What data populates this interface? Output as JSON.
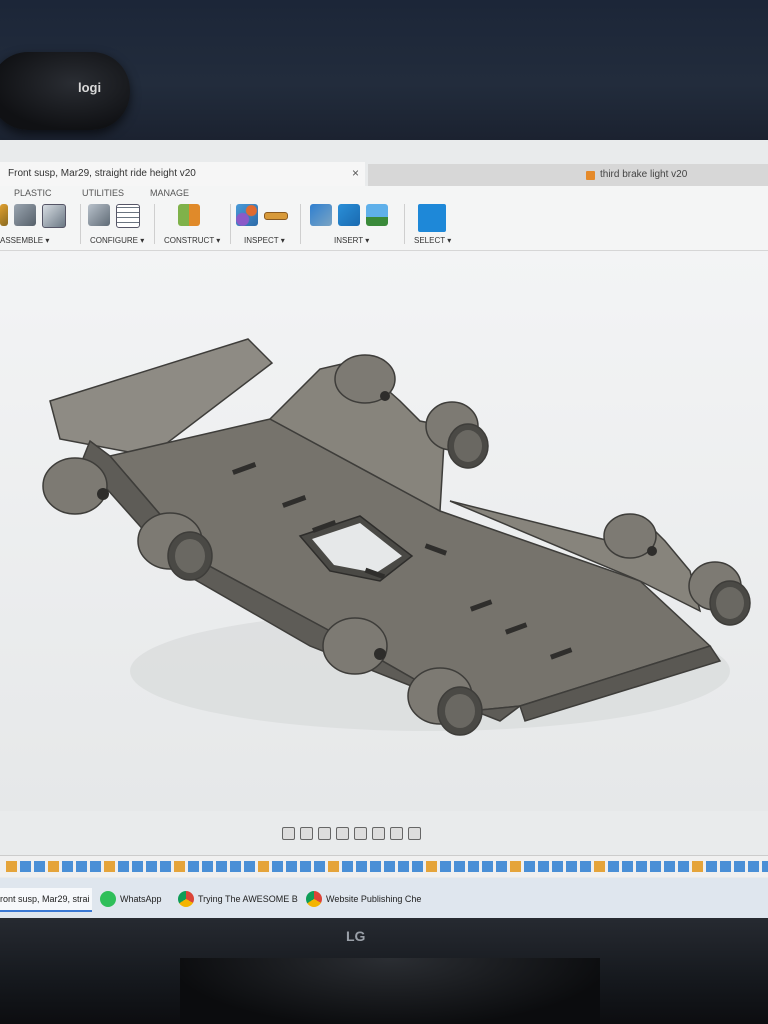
{
  "webcam": {
    "brand": "logi"
  },
  "window": {
    "active_tab_title": "Front susp, Mar29, straight ride height v20",
    "close_glyph": "×",
    "inactive_tab_title": "third brake light v20"
  },
  "ribbon": {
    "tabs": [
      "PLASTIC",
      "UTILITIES",
      "MANAGE"
    ],
    "groups": [
      {
        "label": "ASSEMBLE ▾",
        "icon": "assemble-icon"
      },
      {
        "label": "CONFIGURE ▾",
        "icon": "configure-icon"
      },
      {
        "label": "CONSTRUCT ▾",
        "icon": "construct-icon"
      },
      {
        "label": "INSPECT ▾",
        "icon": "inspect-icon"
      },
      {
        "label": "INSERT ▾",
        "icon": "insert-icon"
      },
      {
        "label": "SELECT ▾",
        "icon": "select-icon"
      }
    ]
  },
  "taskbar": {
    "items": [
      {
        "label": "ront susp, Mar29, strai",
        "icon": "fusion-icon"
      },
      {
        "label": "WhatsApp",
        "icon": "whatsapp-icon"
      },
      {
        "label": "Trying The AWESOME B",
        "icon": "chrome-icon"
      },
      {
        "label": "Website Publishing Che",
        "icon": "chrome-icon"
      }
    ]
  },
  "monitor": {
    "brand": "LG"
  },
  "colors": {
    "accent": "#1e88d8",
    "model_face": "#7d7a73",
    "model_dark": "#55534e",
    "model_light": "#a5a29a"
  }
}
